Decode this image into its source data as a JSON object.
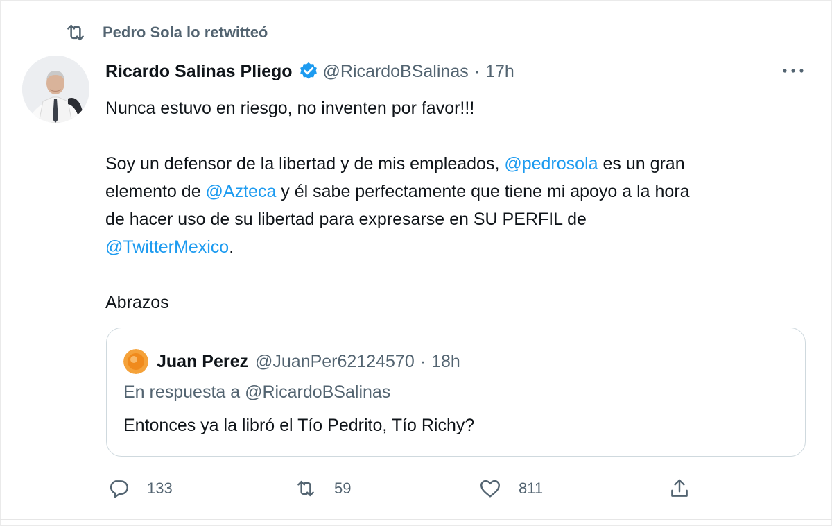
{
  "retweet_header": {
    "text": "Pedro Sola lo retwitteó"
  },
  "tweet": {
    "author_name": "Ricardo Salinas Pliego",
    "handle": "@RicardoBSalinas",
    "separator": "·",
    "time": "17h",
    "verified": true,
    "paragraph1": "Nunca estuvo en riesgo, no inventen por favor!!!",
    "p2_line1_a": "Soy un defensor de la libertad y de mis empleados, ",
    "p2_mention1": "@pedrosola",
    "p2_line1_b": " es un gran",
    "p2_line2_a": "elemento de ",
    "p2_mention2": "@Azteca",
    "p2_line2_b": " y él sabe perfectamente que tiene mi apoyo a la hora",
    "p2_line3": "de hacer uso de su libertad para expresarse en SU PERFIL de",
    "p2_mention3": "@TwitterMexico",
    "p2_line4_end": ".",
    "paragraph3": "Abrazos"
  },
  "quote": {
    "author_name": "Juan Perez",
    "handle": "@JuanPer62124570",
    "separator": "·",
    "time": "18h",
    "reply_to": "En respuesta a @RicardoBSalinas",
    "text": "Entonces ya la libró el Tío Pedrito, Tío Richy?"
  },
  "actions": {
    "replies": "133",
    "retweets": "59",
    "likes": "811"
  },
  "colors": {
    "link": "#1d9bf0",
    "secondary_text": "#536471",
    "primary_text": "#0f1419",
    "verified_badge": "#1d9bf0",
    "border": "#cfd9de"
  },
  "icons": [
    "retweet-icon",
    "verified-badge-icon",
    "more-options-icon",
    "reply-icon",
    "retweet-action-icon",
    "like-icon",
    "share-icon"
  ]
}
